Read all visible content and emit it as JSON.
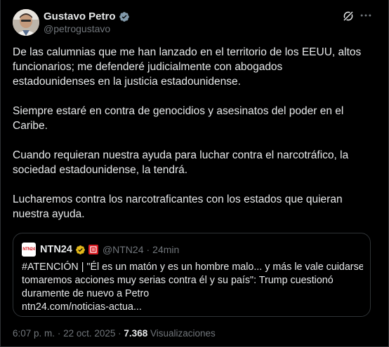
{
  "author": {
    "name": "Gustavo Petro",
    "handle": "@petrogustavo"
  },
  "header": {
    "grok_icon": "grok-icon",
    "more_icon": "more-icon"
  },
  "tweet": {
    "paragraphs": [
      "De las calumnias que me han lanzado en el territorio de los EEUU, altos\nfuncionarios; me defenderé judicialmente con abogados\nestadounidenses en la justicia estadounidense.",
      "Siempre estaré en contra de genocidios y asesinatos del poder en el\nCaribe.",
      "Cuando requieran nuestra ayuda para luchar contra el narcotráfico, la\nsociedad estadounidense, la tendrá.",
      "Lucharemos contra los narcotraficantes con los estados que quieran\nnuestra ayuda."
    ]
  },
  "quote": {
    "avatar_text": "NTN24",
    "name": "NTN24",
    "handle": "@NTN24",
    "separator": "·",
    "time": "24min",
    "lines": [
      "#ATENCIÓN | \"Él es un matón y es un hombre malo... y más le vale cuidarse, o",
      "tomaremos acciones muy serias contra él y su país\": Trump cuestionó",
      "duramente de nuevo a Petro",
      "ntn24.com/noticias-actua..."
    ]
  },
  "meta": {
    "time": "6:07 p. m.",
    "separator": "·",
    "date": "22 oct. 2025",
    "views_count": "7.368",
    "views_label": "Visualizaciones"
  },
  "colors": {
    "background": "#000000",
    "text": "#e7e9ea",
    "secondary": "#71767b",
    "border": "#2f3336",
    "verified_blue": "#829aab",
    "verified_gold": "#e2b719",
    "ntn_red": "#d71920"
  }
}
